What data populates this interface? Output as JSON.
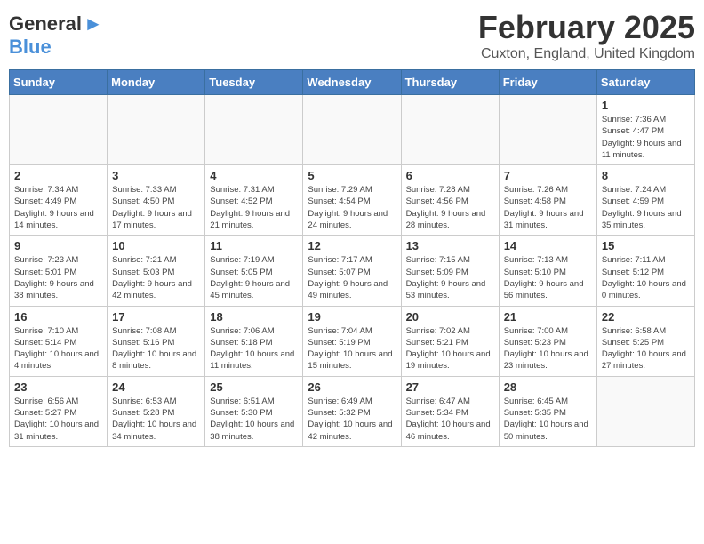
{
  "header": {
    "logo_general": "General",
    "logo_blue": "Blue",
    "month_year": "February 2025",
    "location": "Cuxton, England, United Kingdom"
  },
  "weekdays": [
    "Sunday",
    "Monday",
    "Tuesday",
    "Wednesday",
    "Thursday",
    "Friday",
    "Saturday"
  ],
  "weeks": [
    [
      {
        "day": "",
        "info": ""
      },
      {
        "day": "",
        "info": ""
      },
      {
        "day": "",
        "info": ""
      },
      {
        "day": "",
        "info": ""
      },
      {
        "day": "",
        "info": ""
      },
      {
        "day": "",
        "info": ""
      },
      {
        "day": "1",
        "info": "Sunrise: 7:36 AM\nSunset: 4:47 PM\nDaylight: 9 hours and 11 minutes."
      }
    ],
    [
      {
        "day": "2",
        "info": "Sunrise: 7:34 AM\nSunset: 4:49 PM\nDaylight: 9 hours and 14 minutes."
      },
      {
        "day": "3",
        "info": "Sunrise: 7:33 AM\nSunset: 4:50 PM\nDaylight: 9 hours and 17 minutes."
      },
      {
        "day": "4",
        "info": "Sunrise: 7:31 AM\nSunset: 4:52 PM\nDaylight: 9 hours and 21 minutes."
      },
      {
        "day": "5",
        "info": "Sunrise: 7:29 AM\nSunset: 4:54 PM\nDaylight: 9 hours and 24 minutes."
      },
      {
        "day": "6",
        "info": "Sunrise: 7:28 AM\nSunset: 4:56 PM\nDaylight: 9 hours and 28 minutes."
      },
      {
        "day": "7",
        "info": "Sunrise: 7:26 AM\nSunset: 4:58 PM\nDaylight: 9 hours and 31 minutes."
      },
      {
        "day": "8",
        "info": "Sunrise: 7:24 AM\nSunset: 4:59 PM\nDaylight: 9 hours and 35 minutes."
      }
    ],
    [
      {
        "day": "9",
        "info": "Sunrise: 7:23 AM\nSunset: 5:01 PM\nDaylight: 9 hours and 38 minutes."
      },
      {
        "day": "10",
        "info": "Sunrise: 7:21 AM\nSunset: 5:03 PM\nDaylight: 9 hours and 42 minutes."
      },
      {
        "day": "11",
        "info": "Sunrise: 7:19 AM\nSunset: 5:05 PM\nDaylight: 9 hours and 45 minutes."
      },
      {
        "day": "12",
        "info": "Sunrise: 7:17 AM\nSunset: 5:07 PM\nDaylight: 9 hours and 49 minutes."
      },
      {
        "day": "13",
        "info": "Sunrise: 7:15 AM\nSunset: 5:09 PM\nDaylight: 9 hours and 53 minutes."
      },
      {
        "day": "14",
        "info": "Sunrise: 7:13 AM\nSunset: 5:10 PM\nDaylight: 9 hours and 56 minutes."
      },
      {
        "day": "15",
        "info": "Sunrise: 7:11 AM\nSunset: 5:12 PM\nDaylight: 10 hours and 0 minutes."
      }
    ],
    [
      {
        "day": "16",
        "info": "Sunrise: 7:10 AM\nSunset: 5:14 PM\nDaylight: 10 hours and 4 minutes."
      },
      {
        "day": "17",
        "info": "Sunrise: 7:08 AM\nSunset: 5:16 PM\nDaylight: 10 hours and 8 minutes."
      },
      {
        "day": "18",
        "info": "Sunrise: 7:06 AM\nSunset: 5:18 PM\nDaylight: 10 hours and 11 minutes."
      },
      {
        "day": "19",
        "info": "Sunrise: 7:04 AM\nSunset: 5:19 PM\nDaylight: 10 hours and 15 minutes."
      },
      {
        "day": "20",
        "info": "Sunrise: 7:02 AM\nSunset: 5:21 PM\nDaylight: 10 hours and 19 minutes."
      },
      {
        "day": "21",
        "info": "Sunrise: 7:00 AM\nSunset: 5:23 PM\nDaylight: 10 hours and 23 minutes."
      },
      {
        "day": "22",
        "info": "Sunrise: 6:58 AM\nSunset: 5:25 PM\nDaylight: 10 hours and 27 minutes."
      }
    ],
    [
      {
        "day": "23",
        "info": "Sunrise: 6:56 AM\nSunset: 5:27 PM\nDaylight: 10 hours and 31 minutes."
      },
      {
        "day": "24",
        "info": "Sunrise: 6:53 AM\nSunset: 5:28 PM\nDaylight: 10 hours and 34 minutes."
      },
      {
        "day": "25",
        "info": "Sunrise: 6:51 AM\nSunset: 5:30 PM\nDaylight: 10 hours and 38 minutes."
      },
      {
        "day": "26",
        "info": "Sunrise: 6:49 AM\nSunset: 5:32 PM\nDaylight: 10 hours and 42 minutes."
      },
      {
        "day": "27",
        "info": "Sunrise: 6:47 AM\nSunset: 5:34 PM\nDaylight: 10 hours and 46 minutes."
      },
      {
        "day": "28",
        "info": "Sunrise: 6:45 AM\nSunset: 5:35 PM\nDaylight: 10 hours and 50 minutes."
      },
      {
        "day": "",
        "info": ""
      }
    ]
  ]
}
